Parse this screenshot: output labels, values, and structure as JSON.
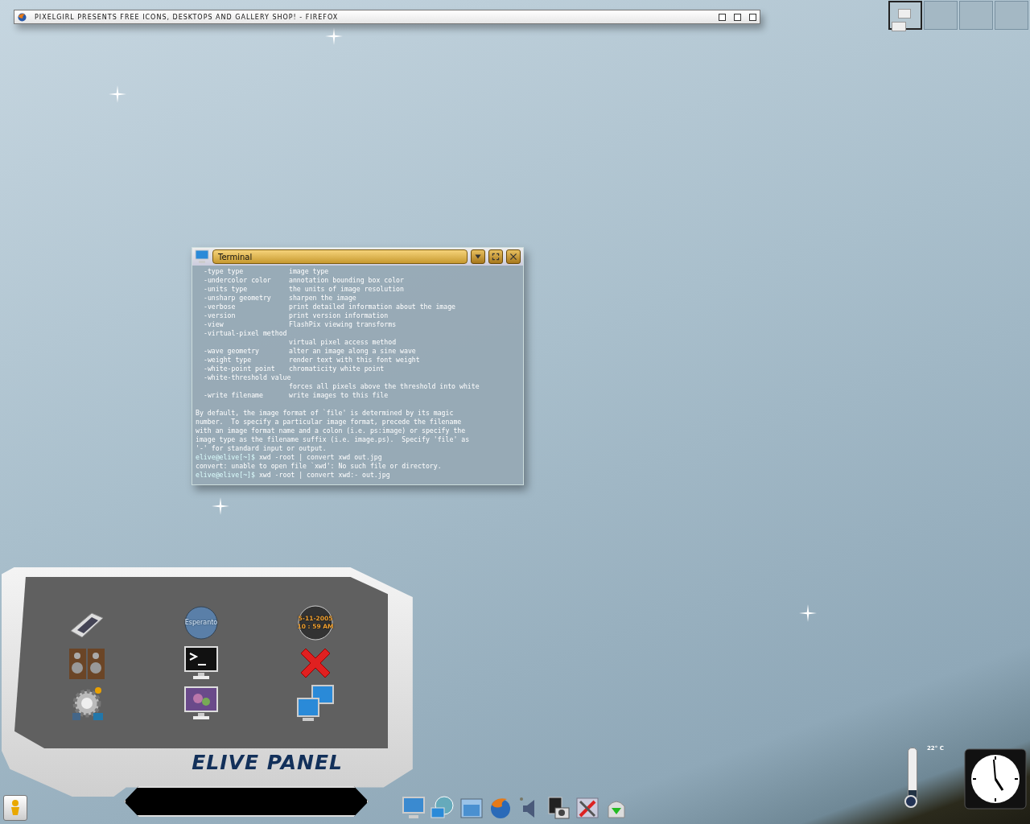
{
  "browser_window": {
    "title": "PIXELGIRL PRESENTS FREE ICONS, DESKTOPS AND GALLERY SHOP! - FIREFOX"
  },
  "pager": [
    {
      "selected": true
    },
    {
      "selected": false
    },
    {
      "selected": false
    },
    {
      "selected": false
    }
  ],
  "terminal": {
    "title": "Terminal",
    "lines": [
      {
        "kind": "option",
        "option": "-type type",
        "description": "image type"
      },
      {
        "kind": "option",
        "option": "-undercolor color",
        "description": "annotation bounding box color"
      },
      {
        "kind": "option",
        "option": "-units type",
        "description": "the units of image resolution"
      },
      {
        "kind": "option",
        "option": "-unsharp geometry",
        "description": "sharpen the image"
      },
      {
        "kind": "option",
        "option": "-verbose",
        "description": "print detailed information about the image"
      },
      {
        "kind": "option",
        "option": "-version",
        "description": "print version information"
      },
      {
        "kind": "option",
        "option": "-view",
        "description": "FlashPix viewing transforms"
      },
      {
        "kind": "option",
        "option": "-virtual-pixel method"
      },
      {
        "kind": "option",
        "description": "virtual pixel access method"
      },
      {
        "kind": "option",
        "option": "-wave geometry",
        "description": "alter an image along a sine wave"
      },
      {
        "kind": "option",
        "option": "-weight type",
        "description": "render text with this font weight"
      },
      {
        "kind": "option",
        "option": "-white-point point",
        "description": "chromaticity white point"
      },
      {
        "kind": "option",
        "option": "-white-threshold value"
      },
      {
        "kind": "option",
        "description": "forces all pixels above the threshold into white"
      },
      {
        "kind": "option",
        "option": "-write filename",
        "description": "write images to this file"
      },
      {
        "kind": "blank"
      },
      {
        "kind": "text",
        "text": "By default, the image format of `file' is determined by its magic"
      },
      {
        "kind": "text",
        "text": "number.  To specify a particular image format, precede the filename"
      },
      {
        "kind": "text",
        "text": "with an image format name and a colon (i.e. ps:image) or specify the"
      },
      {
        "kind": "text",
        "text": "image type as the filename suffix (i.e. image.ps).  Specify 'file' as"
      },
      {
        "kind": "text",
        "text": "'-' for standard input or output."
      },
      {
        "kind": "prompt",
        "prompt": "elive@elive[~]$",
        "command": "xwd -root | convert xwd out.jpg"
      },
      {
        "kind": "text",
        "text": "convert: unable to open file `xwd': No such file or directory."
      },
      {
        "kind": "prompt",
        "prompt": "elive@elive[~]$",
        "command": "xwd -root | convert xwd:- out.jpg"
      }
    ]
  },
  "elive_panel": {
    "title": "ELIVE PANEL",
    "launchers": [
      {
        "kind": "tablet"
      },
      {
        "kind": "globe",
        "label": "Esperanto"
      },
      {
        "kind": "world-clock",
        "date": "5-11-2005",
        "time": "10 : 59 AM"
      },
      {
        "kind": "speakers"
      },
      {
        "kind": "terminal"
      },
      {
        "kind": "close"
      },
      {
        "kind": "gear"
      },
      {
        "kind": "wallpaper"
      },
      {
        "kind": "network"
      }
    ]
  },
  "dock": [
    {
      "kind": "monitor"
    },
    {
      "kind": "network-globe"
    },
    {
      "kind": "folder"
    },
    {
      "kind": "browser"
    },
    {
      "kind": "speaker"
    },
    {
      "kind": "camera"
    },
    {
      "kind": "tools"
    },
    {
      "kind": "drive"
    }
  ],
  "thermometer": {
    "reading": "22° C",
    "level": 0.18
  }
}
